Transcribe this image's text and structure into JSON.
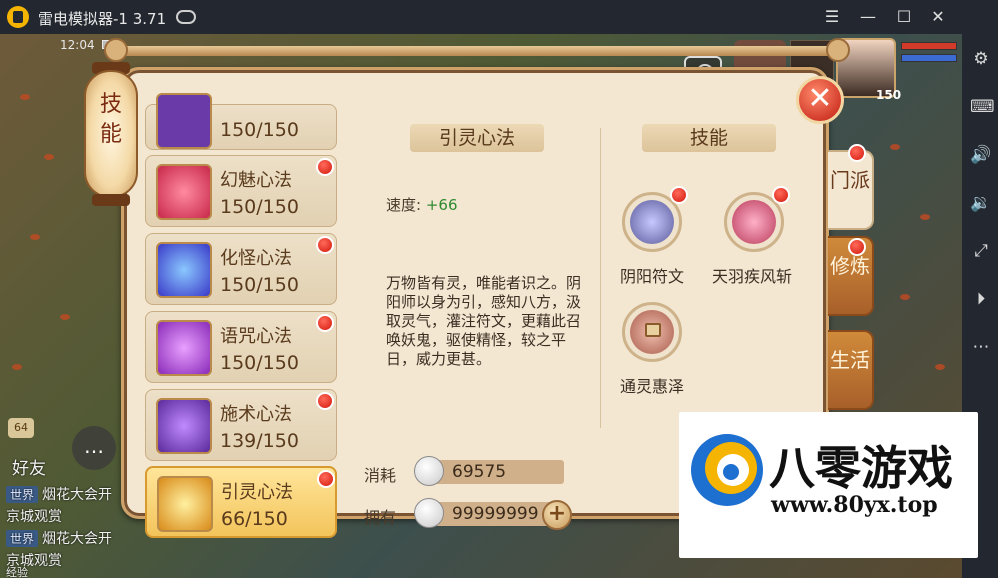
{
  "window": {
    "title": "雷电模拟器-1 3.71",
    "controls": [
      "menu-icon",
      "minimize-icon",
      "maximize-icon",
      "close-icon",
      "collapse-icon"
    ]
  },
  "sidebar": {
    "icons": [
      "settings-icon",
      "keyboard-icon",
      "volume-up-icon",
      "volume-down-icon",
      "fullscreen-icon",
      "record-icon",
      "more-icon"
    ]
  },
  "status": {
    "time": "12:04"
  },
  "hud": {
    "level": "150",
    "hp_color": "#d23a2a",
    "mp_color": "#3a6ad2"
  },
  "chat": {
    "badge": "64",
    "friends_label": "好友",
    "lines": [
      {
        "tag": "世界",
        "text": "烟花大会开"
      },
      {
        "text": "京城观赏"
      },
      {
        "tag": "世界",
        "text": "烟花大会开"
      },
      {
        "text": "京城观赏"
      }
    ],
    "bottom_label": "经验"
  },
  "panel": {
    "title": "技能",
    "list": [
      {
        "name": "",
        "value": "150/150",
        "color": "#6a3aa8",
        "dot": false
      },
      {
        "name": "幻魅心法",
        "value": "150/150",
        "color": "#c8284a",
        "dot": true
      },
      {
        "name": "化怪心法",
        "value": "150/150",
        "color": "#3a3ac8",
        "dot": true
      },
      {
        "name": "语咒心法",
        "value": "150/150",
        "color": "#8a2ab8",
        "dot": true
      },
      {
        "name": "施术心法",
        "value": "139/150",
        "color": "#5a2a9a",
        "dot": true
      },
      {
        "name": "引灵心法",
        "value": "66/150",
        "color": "#d88a18",
        "dot": true,
        "selected": true
      }
    ],
    "detail": {
      "title": "引灵心法",
      "speed_label": "速度:",
      "speed_value": "+66",
      "description": "万物皆有灵，唯能者识之。阴阳师以身为引，感知八方，汲取灵气，灌注符文，更藉此召唤妖鬼，驱使精怪，较之平日，威力更甚。"
    },
    "skills": {
      "title": "技能",
      "items": [
        {
          "name": "阴阳符文",
          "color": "#5a5a9a",
          "dot": true
        },
        {
          "name": "天羽疾风斩",
          "color": "#b83a5a",
          "dot": true
        },
        {
          "name": "通灵惠泽",
          "color": "#a85a4a",
          "dot": false,
          "locked": true
        }
      ]
    },
    "cost": {
      "consume_label": "消耗",
      "consume_value": "69575",
      "own_label": "拥有",
      "own_value": "99999999",
      "add_button": "+"
    },
    "tabs": [
      {
        "label": "门派",
        "active": true,
        "dot": true
      },
      {
        "label": "修炼",
        "active": false,
        "dot": true
      },
      {
        "label": "生活",
        "active": false,
        "dot": false
      }
    ],
    "close_glyph": "✕"
  },
  "watermark": {
    "big": "八零游戏",
    "url": "www.80yx.top"
  }
}
